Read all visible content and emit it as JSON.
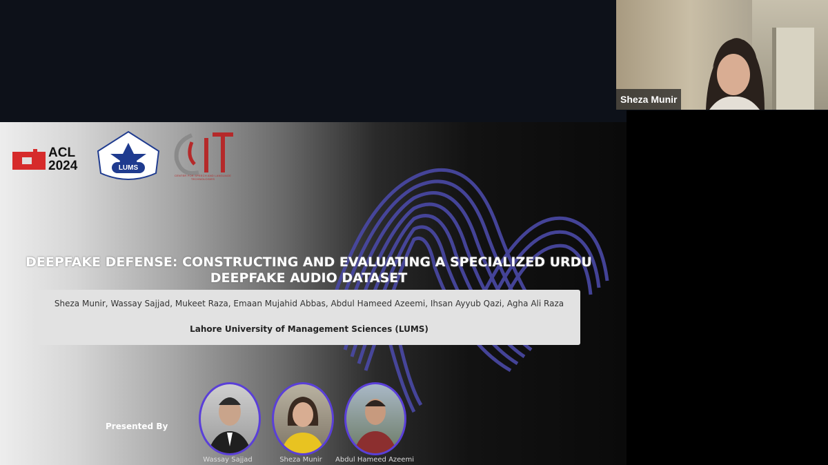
{
  "participant": {
    "name": "Sheza Munir"
  },
  "slide": {
    "logos": {
      "acl": {
        "line1": "ACL",
        "line2": "2024"
      },
      "lums": {
        "label": "LUMS"
      },
      "csalt": {
        "caption": "CENTER FOR SPEECH AND LANGUAGE TECHNOLOGIES"
      }
    },
    "title_line1": "DEEPFAKE DEFENSE: CONSTRUCTING AND EVALUATING A SPECIALIZED URDU",
    "title_line2": "DEEPFAKE AUDIO DATASET",
    "authors": "Sheza Munir, Wassay Sajjad, Mukeet Raza, Emaan Mujahid Abbas, Abdul Hameed Azeemi, Ihsan Ayyub Qazi, Agha Ali Raza",
    "affiliation": "Lahore University of Management Sciences (LUMS)",
    "presented_by": "Presented By",
    "presenters": [
      {
        "name": "Wassay Sajjad"
      },
      {
        "name": "Sheza Munir"
      },
      {
        "name": "Abdul Hameed Azeemi"
      }
    ],
    "colors": {
      "accent": "#5a3fd8",
      "wave": "#4a49a6",
      "acl_red": "#d62b2b",
      "lums_blue": "#1f3b8f"
    }
  }
}
